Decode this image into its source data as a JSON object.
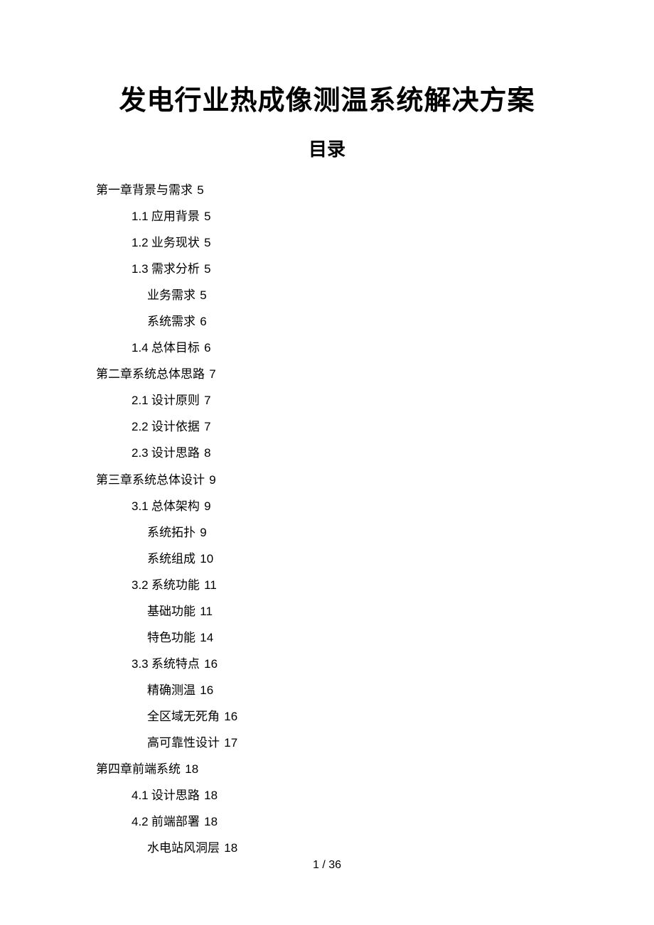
{
  "title": "发电行业热成像测温系统解决方案",
  "toc_heading": "目录",
  "entries": [
    {
      "level": 0,
      "num": "",
      "label": "第一章背景与需求",
      "page": "5"
    },
    {
      "level": 1,
      "num": "1.1",
      "label": "应用背景",
      "page": "5"
    },
    {
      "level": 1,
      "num": "1.2",
      "label": "业务现状",
      "page": "5"
    },
    {
      "level": 1,
      "num": "1.3",
      "label": "需求分析",
      "page": "5"
    },
    {
      "level": 2,
      "num": "",
      "label": "业务需求",
      "page": "5"
    },
    {
      "level": 2,
      "num": "",
      "label": "系统需求",
      "page": "6"
    },
    {
      "level": 1,
      "num": "1.4",
      "label": "总体目标",
      "page": "6"
    },
    {
      "level": 0,
      "num": "",
      "label": "第二章系统总体思路",
      "page": "7"
    },
    {
      "level": 1,
      "num": "2.1",
      "label": "设计原则",
      "page": "7"
    },
    {
      "level": 1,
      "num": "2.2",
      "label": "设计依据",
      "page": "7"
    },
    {
      "level": 1,
      "num": "2.3",
      "label": "设计思路",
      "page": "8"
    },
    {
      "level": 0,
      "num": "",
      "label": "第三章系统总体设计",
      "page": "9"
    },
    {
      "level": 1,
      "num": "3.1",
      "label": "总体架构",
      "page": "9"
    },
    {
      "level": 2,
      "num": "",
      "label": "系统拓扑",
      "page": "9"
    },
    {
      "level": 2,
      "num": "",
      "label": "系统组成",
      "page": "10"
    },
    {
      "level": 1,
      "num": "3.2",
      "label": "系统功能",
      "page": "11"
    },
    {
      "level": 2,
      "num": "",
      "label": "基础功能",
      "page": "11"
    },
    {
      "level": 2,
      "num": "",
      "label": "特色功能",
      "page": "14"
    },
    {
      "level": 1,
      "num": "3.3",
      "label": "系统特点",
      "page": "16"
    },
    {
      "level": 2,
      "num": "",
      "label": "精确测温",
      "page": "16"
    },
    {
      "level": 2,
      "num": "",
      "label": "全区域无死角",
      "page": "16"
    },
    {
      "level": 2,
      "num": "",
      "label": "高可靠性设计",
      "page": "17"
    },
    {
      "level": 0,
      "num": "",
      "label": "第四章前端系统",
      "page": "18"
    },
    {
      "level": 1,
      "num": "4.1",
      "label": "设计思路",
      "page": "18"
    },
    {
      "level": 1,
      "num": "4.2",
      "label": "前端部署",
      "page": "18"
    },
    {
      "level": 2,
      "num": "",
      "label": "水电站风洞层",
      "page": "18"
    }
  ],
  "footer": {
    "current_page": "1",
    "separator": " / ",
    "total_pages": "36"
  }
}
